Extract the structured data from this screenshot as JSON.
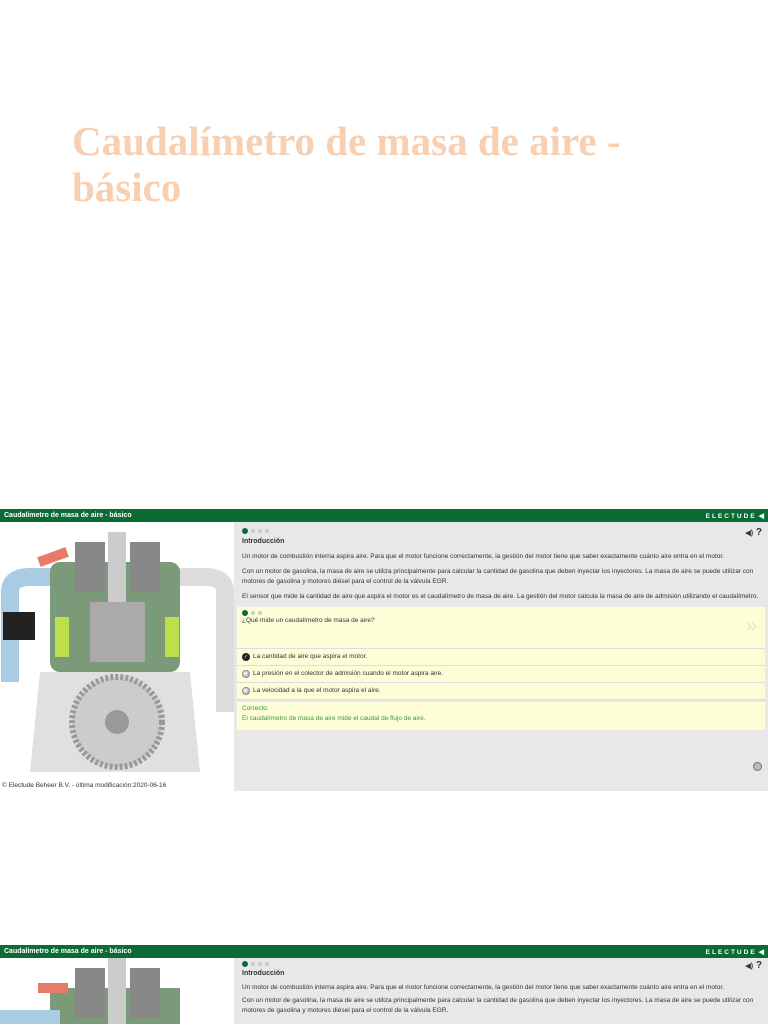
{
  "slide_title": "Caudalímetro de masa de aire - básico",
  "module": {
    "header_title": "Caudalímetro de masa de aire - básico",
    "brand": "ELECTUDE",
    "collapse_icon": "◀",
    "sound_icon": "◀)",
    "help_icon": "?",
    "copyright": "© Electude Beheer B.V. - última modificación:2020-06-16",
    "section_title": "Introducción",
    "paragraphs": [
      "Un motor de combustión interna aspira aire. Para que el motor funcione correctamente, la gestión del motor tiene que saber exactamente cuánto aire entra en el motor.",
      "Con un motor de gasolina, la masa de aire se utiliza principalmente para calcular la cantidad de gasolina que deben inyectar los inyectores. La masa de aire se puede utilizar con motores de gasolina y motores diésel para el control de la válvula EGR.",
      "El sensor que mide la cantidad de aire que aspira el motor es el caudalímetro de masa de aire. La gestión del motor calcula la masa de aire de admisión utilizando el caudalímetro."
    ],
    "question": "¿Qué mide un caudalímetro de masa de aire?",
    "options": [
      "La cantidad de aire que aspira el motor.",
      "La presión en el colector de admisión cuando el motor aspira aire.",
      "La velocidad a la que el motor aspira el aire."
    ],
    "feedback_title": "Correcto.",
    "feedback_text": "El caudalímetro de masa de aire mide el caudal de flujo de aire.",
    "accent": "#0b6b34"
  }
}
